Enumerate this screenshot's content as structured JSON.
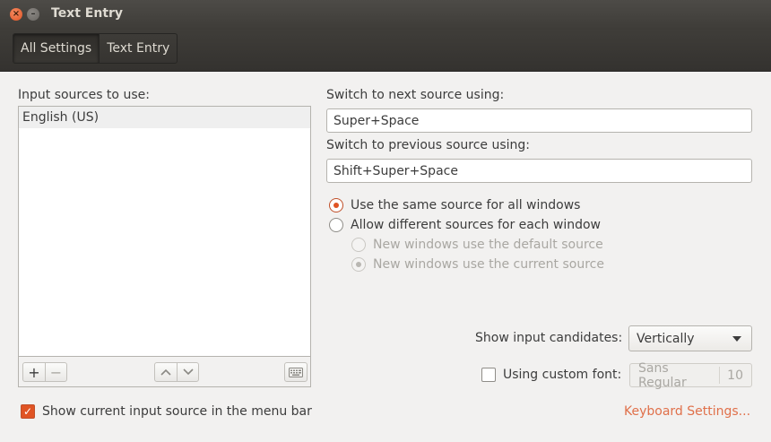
{
  "window": {
    "title": "Text Entry",
    "close_glyph": "×",
    "min_glyph": "–"
  },
  "breadcrumbs": [
    "All Settings",
    "Text Entry"
  ],
  "input_sources": {
    "label": "Input sources to use:",
    "items": [
      "English (US)"
    ],
    "add_glyph": "+",
    "remove_glyph": "−",
    "up_glyph": "⌃",
    "down_glyph": "⌄",
    "keyboard_glyph": "⌨"
  },
  "shortcuts": {
    "next_label": "Switch to next source using:",
    "next_value": "Super+Space",
    "prev_label": "Switch to previous source using:",
    "prev_value": "Shift+Super+Space"
  },
  "source_mode": {
    "same_label": "Use the same source for all windows",
    "different_label": "Allow different sources for each window",
    "default_label": "New windows use the default source",
    "current_label": "New windows use the current source",
    "selected": "same"
  },
  "candidates": {
    "label": "Show input candidates:",
    "value": "Vertically"
  },
  "custom_font": {
    "label": "Using custom font:",
    "checked": false,
    "font_name": "Sans Regular",
    "font_size": "10"
  },
  "menu_bar": {
    "label": "Show current input source in the menu bar",
    "checked": true,
    "check_glyph": "✓"
  },
  "link": {
    "label": "Keyboard Settings..."
  },
  "colors": {
    "accent": "#e05424",
    "titlebar": "#3e3c38",
    "link": "#e0704a"
  }
}
